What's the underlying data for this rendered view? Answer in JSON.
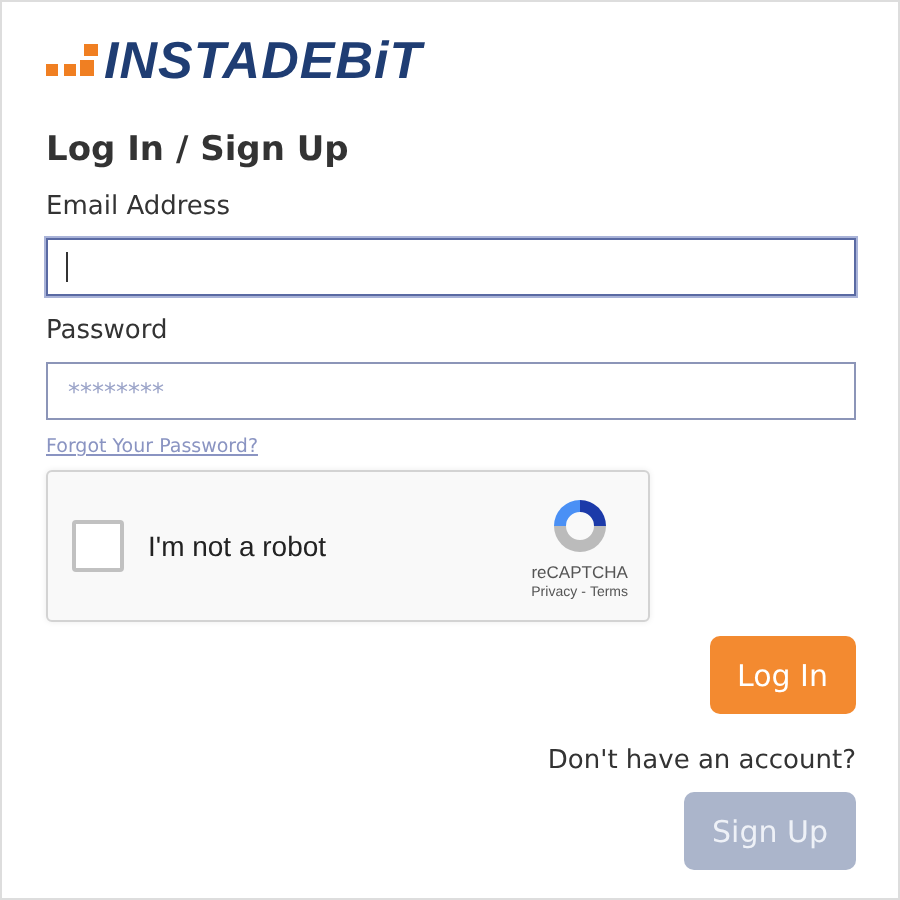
{
  "logo": {
    "text": "INSTADEBiT"
  },
  "heading": "Log In / Sign Up",
  "fields": [
    {
      "label": "Email Address",
      "focused": true
    },
    {
      "label": "Password",
      "placeholder": "********",
      "focused": false
    }
  ],
  "forgot_link": "Forgot Your Password?",
  "captcha": {
    "label": "I'm not a robot",
    "checked": false,
    "brand": "reCAPTCHA",
    "privacy": "Privacy",
    "separator": "-",
    "terms": "Terms"
  },
  "login_button": {
    "label": "Log In",
    "disabled": false
  },
  "signup_prompt": "Don't have an account?",
  "signup_button": {
    "label": "Sign Up",
    "disabled": true
  }
}
